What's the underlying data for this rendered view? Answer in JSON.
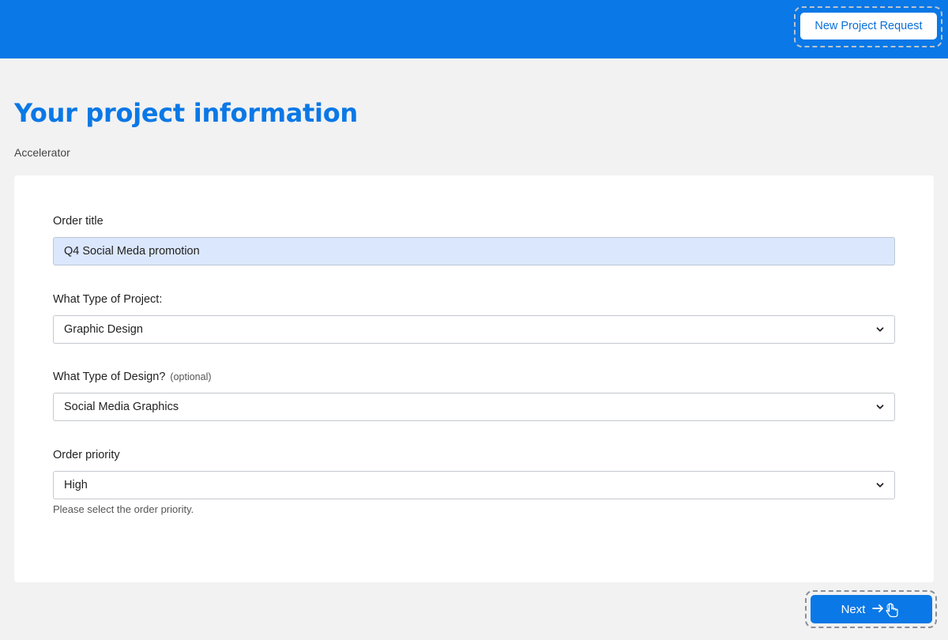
{
  "header": {
    "new_project_label": "New Project Request"
  },
  "page": {
    "title": "Your project information",
    "subtitle": "Accelerator"
  },
  "form": {
    "order_title": {
      "label": "Order title",
      "value": "Q4 Social Meda promotion"
    },
    "project_type": {
      "label": "What Type of Project:",
      "value": "Graphic Design"
    },
    "design_type": {
      "label": "What Type of Design?",
      "optional": "(optional)",
      "value": "Social Media Graphics"
    },
    "priority": {
      "label": "Order priority",
      "value": "High",
      "helper": "Please select the order priority."
    }
  },
  "footer": {
    "next_label": "Next"
  },
  "colors": {
    "brand": "#0a78e6",
    "input_filled_bg": "#dbe7fc",
    "page_bg": "#f2f2f2"
  },
  "icons": {
    "dropdown": "chevron-down-icon",
    "next_arrow": "arrow-right-icon",
    "cursor": "hand-pointer-icon"
  }
}
